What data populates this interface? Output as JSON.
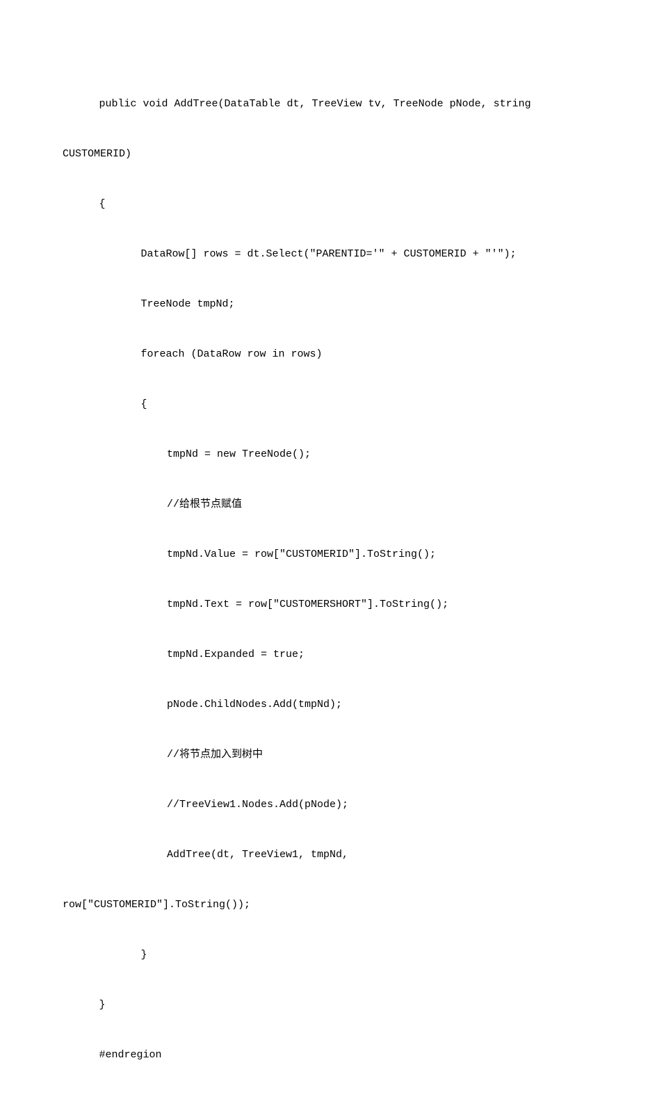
{
  "code": {
    "l01": "public void AddTree(DataTable dt, TreeView tv, TreeNode pNode, string",
    "l02": "CUSTOMERID)",
    "l03": "{",
    "l04": "DataRow[] rows = dt.Select(\"PARENTID='\" + CUSTOMERID + \"'\");",
    "l05": "TreeNode tmpNd;",
    "l06": "foreach (DataRow row in rows)",
    "l07": "{",
    "l08": "tmpNd = new TreeNode();",
    "l09": "//给根节点赋值",
    "l10": "tmpNd.Value = row[\"CUSTOMERID\"].ToString();",
    "l11": "tmpNd.Text = row[\"CUSTOMERSHORT\"].ToString();",
    "l12": "tmpNd.Expanded = true;",
    "l13": "pNode.ChildNodes.Add(tmpNd);",
    "l14": "//将节点加入到树中",
    "l15": "//TreeView1.Nodes.Add(pNode);",
    "l16": "AddTree(dt, TreeView1, tmpNd,",
    "l17": "row[\"CUSTOMERID\"].ToString());",
    "l18": "}",
    "l19": "}",
    "l20": "#endregion"
  }
}
